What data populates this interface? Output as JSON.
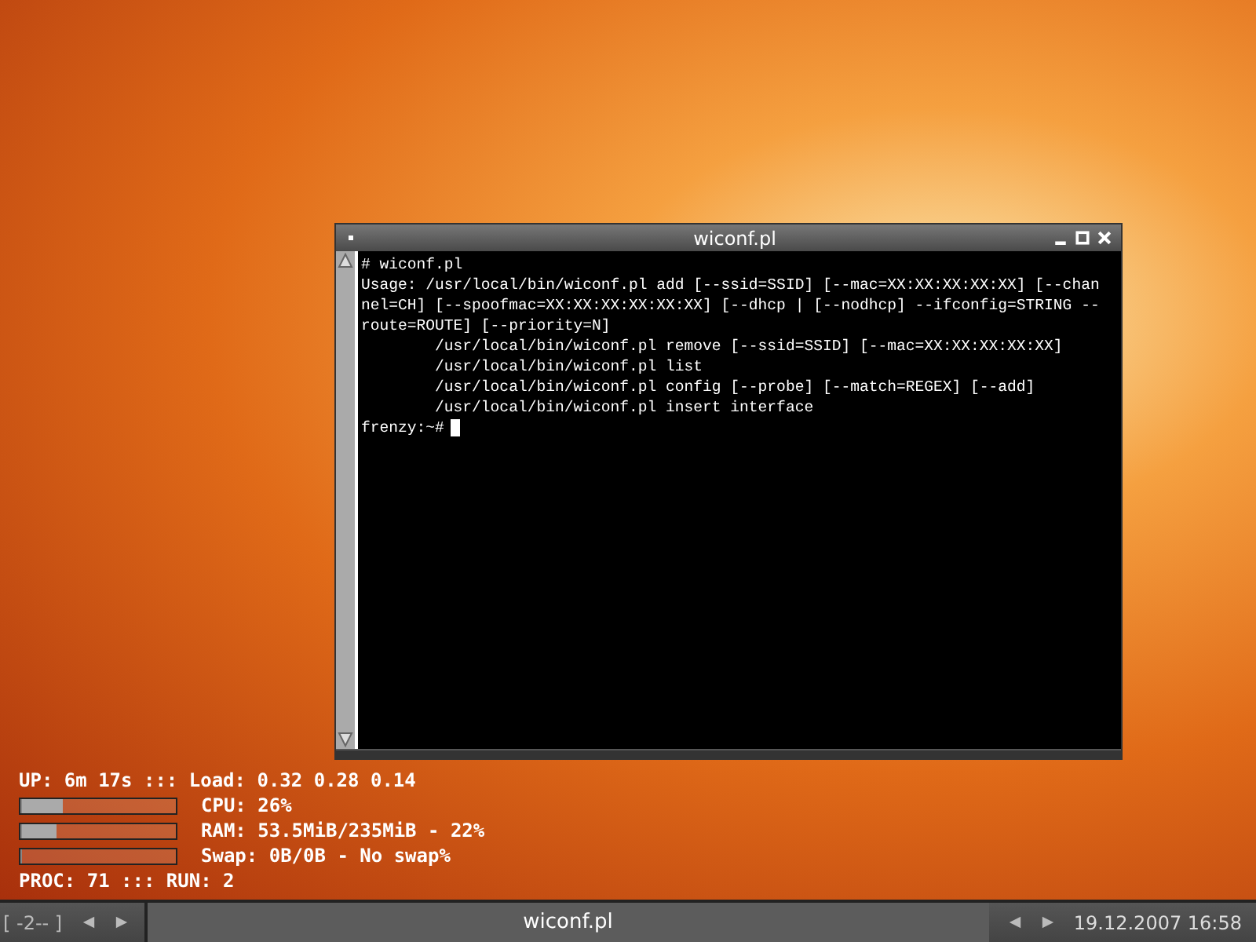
{
  "terminal_window": {
    "title": "wiconf.pl",
    "lines": [
      "# wiconf.pl",
      "Usage: /usr/local/bin/wiconf.pl add [--ssid=SSID] [--mac=XX:XX:XX:XX:XX] [--chan",
      "nel=CH] [--spoofmac=XX:XX:XX:XX:XX:XX] [--dhcp | [--nodhcp] --ifconfig=STRING --",
      "route=ROUTE] [--priority=N]",
      "        /usr/local/bin/wiconf.pl remove [--ssid=SSID] [--mac=XX:XX:XX:XX:XX]",
      "        /usr/local/bin/wiconf.pl list",
      "        /usr/local/bin/wiconf.pl config [--probe] [--match=REGEX] [--add]",
      "        /usr/local/bin/wiconf.pl insert interface"
    ],
    "prompt": "frenzy:~#"
  },
  "system_monitor": {
    "uptime_line": "UP: 6m 17s ::: Load: 0.32 0.28 0.14",
    "meters": [
      {
        "label": "CPU: 26%",
        "level": 0.26
      },
      {
        "label": "RAM: 53.5MiB/235MiB - 22%",
        "level": 0.22
      },
      {
        "label": "Swap: 0B/0B - No swap%",
        "level": 0
      }
    ],
    "process_line": "PROC: 71 ::: RUN: 2"
  },
  "taskbar": {
    "desktop": "[ -2-- ]",
    "task": "wiconf.pl",
    "clock": "19.12.2007 16:58"
  }
}
